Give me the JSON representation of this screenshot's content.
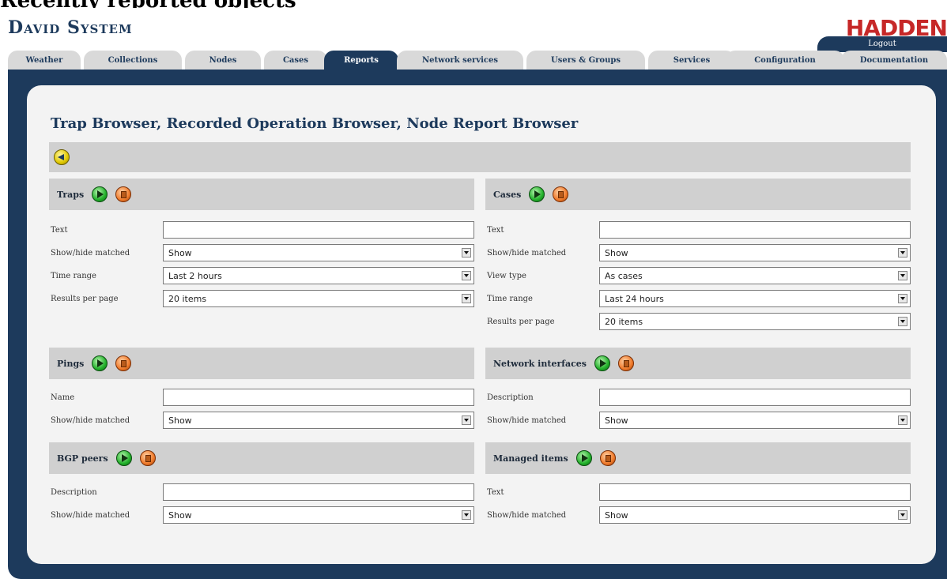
{
  "heading_cut": "Recently reported objects",
  "app": {
    "title": "David System",
    "brand": "HADDEN",
    "logout_label": "Logout"
  },
  "tabs": [
    {
      "label": "Weather"
    },
    {
      "label": "Collections"
    },
    {
      "label": "Nodes"
    },
    {
      "label": "Cases"
    },
    {
      "label": "Reports",
      "active": true
    },
    {
      "label": "Network services"
    },
    {
      "label": "Users & Groups"
    },
    {
      "label": "Services"
    },
    {
      "label": "Configuration"
    },
    {
      "label": "Documentation"
    }
  ],
  "page": {
    "title": "Trap Browser, Recorded Operation Browser, Node Report Browser"
  },
  "sections": {
    "traps": {
      "title": "Traps",
      "rows": [
        {
          "label": "Text",
          "type": "input",
          "value": ""
        },
        {
          "label": "Show/hide matched",
          "type": "select",
          "value": "Show"
        },
        {
          "label": "Time range",
          "type": "select",
          "value": "Last 2 hours"
        },
        {
          "label": "Results per page",
          "type": "select",
          "value": "20 items"
        }
      ]
    },
    "cases": {
      "title": "Cases",
      "rows": [
        {
          "label": "Text",
          "type": "input",
          "value": ""
        },
        {
          "label": "Show/hide matched",
          "type": "select",
          "value": "Show"
        },
        {
          "label": "View type",
          "type": "select",
          "value": "As cases"
        },
        {
          "label": "Time range",
          "type": "select",
          "value": "Last 24 hours"
        },
        {
          "label": "Results per page",
          "type": "select",
          "value": "20 items"
        }
      ]
    },
    "pings": {
      "title": "Pings",
      "rows": [
        {
          "label": "Name",
          "type": "input",
          "value": ""
        },
        {
          "label": "Show/hide matched",
          "type": "select",
          "value": "Show"
        }
      ]
    },
    "network_interfaces": {
      "title": "Network interfaces",
      "rows": [
        {
          "label": "Description",
          "type": "input",
          "value": ""
        },
        {
          "label": "Show/hide matched",
          "type": "select",
          "value": "Show"
        }
      ]
    },
    "bgp_peers": {
      "title": "BGP peers",
      "rows": [
        {
          "label": "Description",
          "type": "input",
          "value": ""
        },
        {
          "label": "Show/hide matched",
          "type": "select",
          "value": "Show"
        }
      ]
    },
    "managed_items": {
      "title": "Managed items",
      "rows": [
        {
          "label": "Text",
          "type": "input",
          "value": ""
        },
        {
          "label": "Show/hide matched",
          "type": "select",
          "value": "Show"
        }
      ]
    }
  },
  "colors": {
    "navy": "#1d3a5c",
    "brand_red": "#c62828",
    "panel": "#f3f3f3",
    "section_bar": "#d0d0d0"
  },
  "icons": {
    "back": "back-arrow-icon",
    "go": "go-icon",
    "clear": "clear-icon"
  }
}
